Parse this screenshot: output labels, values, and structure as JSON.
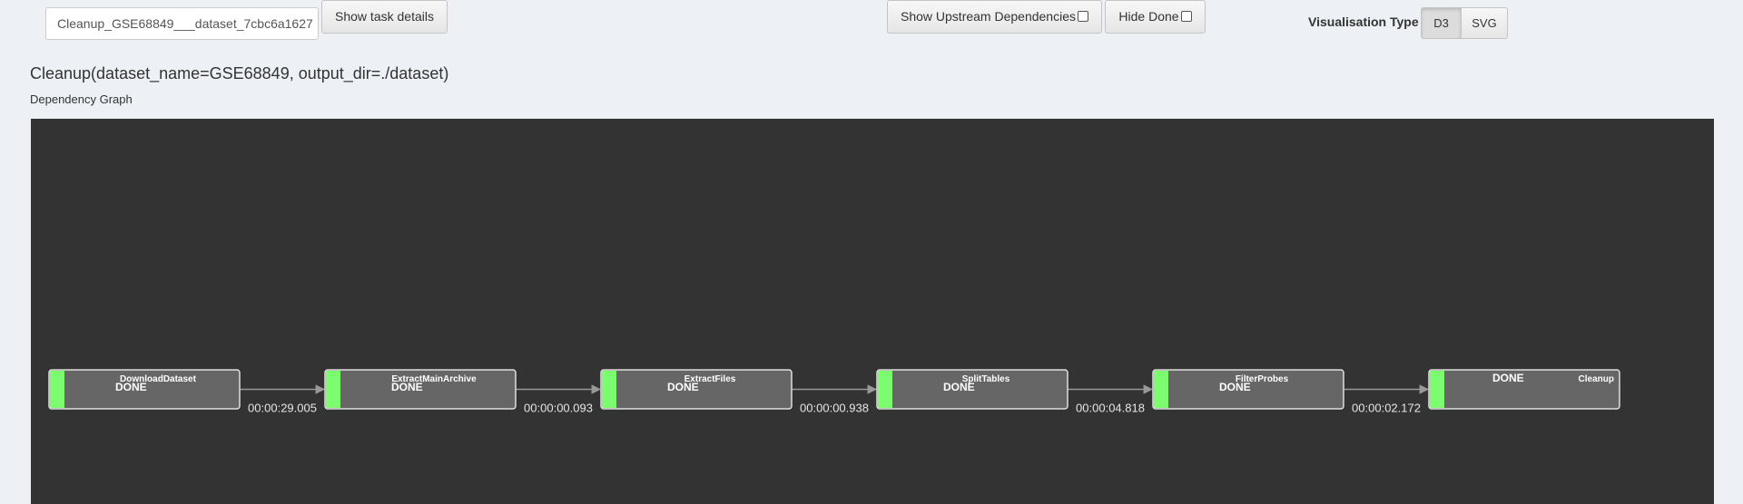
{
  "toolbar": {
    "task_id": "Cleanup_GSE68849___dataset_7cbc6a1627",
    "show_task_details_label": "Show task details",
    "show_upstream_label": "Show Upstream Dependencies",
    "hide_done_label": "Hide Done",
    "visualisation_type_label": "Visualisation Type",
    "vis_options": [
      "D3",
      "SVG"
    ],
    "vis_selected": "D3"
  },
  "page": {
    "title": "Cleanup(dataset_name=GSE68849, output_dir=./dataset)",
    "graph_label": "Dependency Graph"
  },
  "graph": {
    "background": "#333333",
    "node_fill": "#666666",
    "node_border": "#e0e0e0",
    "status_color": "#7cfc6f",
    "nodes": [
      {
        "name": "DownloadDataset",
        "status": "DONE"
      },
      {
        "name": "ExtractMainArchive",
        "status": "DONE"
      },
      {
        "name": "ExtractFiles",
        "status": "DONE"
      },
      {
        "name": "SplitTables",
        "status": "DONE"
      },
      {
        "name": "FilterProbes",
        "status": "DONE"
      },
      {
        "name": "Cleanup",
        "status": "DONE"
      }
    ],
    "edges": [
      {
        "duration": "00:00:29.005"
      },
      {
        "duration": "00:00:00.093"
      },
      {
        "duration": "00:00:00.938"
      },
      {
        "duration": "00:00:04.818"
      },
      {
        "duration": "00:00:02.172"
      }
    ]
  }
}
